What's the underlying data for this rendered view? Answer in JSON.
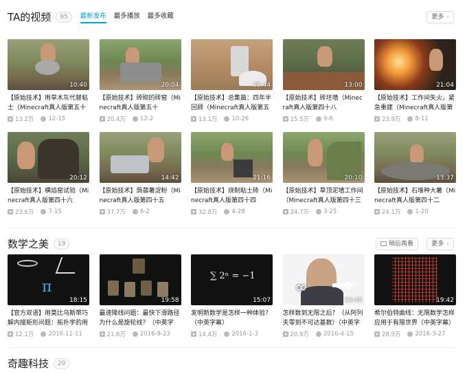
{
  "section1": {
    "title": "TA的视频",
    "count": "95",
    "tabs": [
      "最新发布",
      "最多播放",
      "最多收藏"
    ],
    "more": "更多",
    "videos": [
      {
        "title": "【原始技术】用草木灰代替粘土（Minecraft真人版第五十",
        "duration": "10:40",
        "views": "13.2万",
        "date": "12-15"
      },
      {
        "title": "【原始技术】砖砌的砖窑（Minecraft真人版第五十",
        "duration": "20:04",
        "views": "20.4万",
        "date": "12-2"
      },
      {
        "title": "【原始技术】总集篇：四年半回顾（Minecraft真人版第五",
        "duration": "35:44",
        "views": "13.1万",
        "date": "10-26"
      },
      {
        "title": "【原始技术】砖坯墙（Minecraft真人版第四十八",
        "duration": "13:00",
        "views": "15.5万",
        "date": "9-6"
      },
      {
        "title": "【原始技术】工作间失火，紧急重建（Minecraft真人版第",
        "duration": "21:04",
        "views": "23.9万",
        "date": "8-11"
      },
      {
        "title": "【原始技术】横焰窑试验（Minecraft真人版第四十六",
        "duration": "20:12",
        "views": "23.6万",
        "date": "7-15"
      },
      {
        "title": "【原始技术】蒟蒻薯淀粉（Minecraft真人版第四十五",
        "duration": "14:42",
        "views": "37.7万",
        "date": "6-2"
      },
      {
        "title": "【原始技术】烧制粘土砖（Minecraft真人版第四十四",
        "duration": "21:16",
        "views": "32.8万",
        "date": "4-28"
      },
      {
        "title": "【原始技术】草顶泥墙工作间（Minecraft真人版第四十三",
        "duration": "20:10",
        "views": "24.7万",
        "date": "3-25"
      },
      {
        "title": "【原始技术】石堆种大薯（Minecraft真人版第四十二",
        "duration": "13:37",
        "views": "24.1万",
        "date": "1-20"
      }
    ]
  },
  "section2": {
    "title": "数学之美",
    "count": "19",
    "later": "稍后再看",
    "more": "更多",
    "videos": [
      {
        "title": "【官方双语】用莫比乌斯带巧解内接矩形问题：拓扑学的用",
        "duration": "18:15",
        "views": "12.1万",
        "date": "2016-11-11"
      },
      {
        "title": "最速降线问题：最快下滑路径为什么是旋轮线？（中英字",
        "duration": "19:58",
        "views": "21.6万",
        "date": "2016-9-23"
      },
      {
        "title": "发明新数学是怎样一种体验？（中英字幕）",
        "duration": "15:07",
        "views": "14.4万",
        "date": "2016-1-3",
        "formula": "∑ 2ⁿ = −1"
      },
      {
        "title": "怎样数到无限之后？（从阿列夫零到不可达基数）（中英字",
        "duration": "23:45",
        "views": "20.9万",
        "date": "2016-4-15"
      },
      {
        "title": "希尔伯特曲线：无限数学怎样应用于有限世界（中英字幕）",
        "duration": "19:42",
        "views": "28.9万",
        "date": "2016-3-27"
      }
    ]
  },
  "section3": {
    "title": "奇趣科技",
    "count": "20"
  },
  "colors": {
    "accent": "#00a1d6",
    "muted": "#999999"
  },
  "icons": {
    "play": "play-count-icon",
    "danmaku": "danmaku-icon",
    "chevron": "chevron-right-icon"
  }
}
